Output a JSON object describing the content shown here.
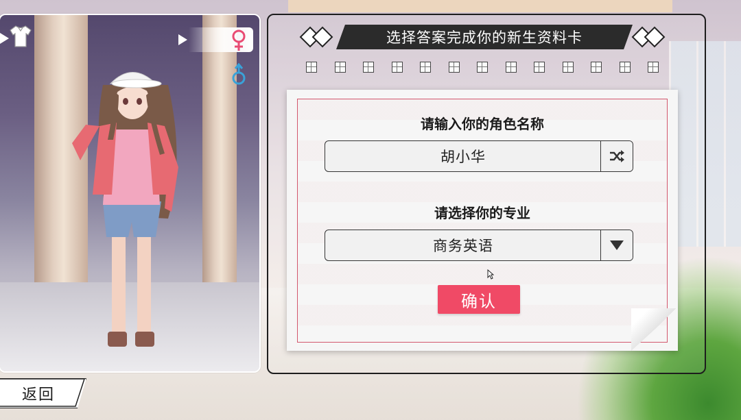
{
  "card": {
    "title": "选择答案完成你的新生资料卡",
    "progress_total": 13
  },
  "form": {
    "name_label": "请输入你的角色名称",
    "name_value": "胡小华",
    "random_icon": "shuffle-icon",
    "major_label": "请选择你的专业",
    "major_value": "商务英语",
    "confirm_label": "确认"
  },
  "character_panel": {
    "outfit_icon": "shirt-icon",
    "gender_selected": "female",
    "female_icon": "female-icon",
    "male_icon": "male-icon"
  },
  "footer": {
    "back_label": "返回"
  },
  "colors": {
    "accent_red": "#f04a66",
    "female_pink": "#e94b73",
    "male_blue": "#3aa2d8",
    "banner_dark": "#2b2b2b"
  }
}
